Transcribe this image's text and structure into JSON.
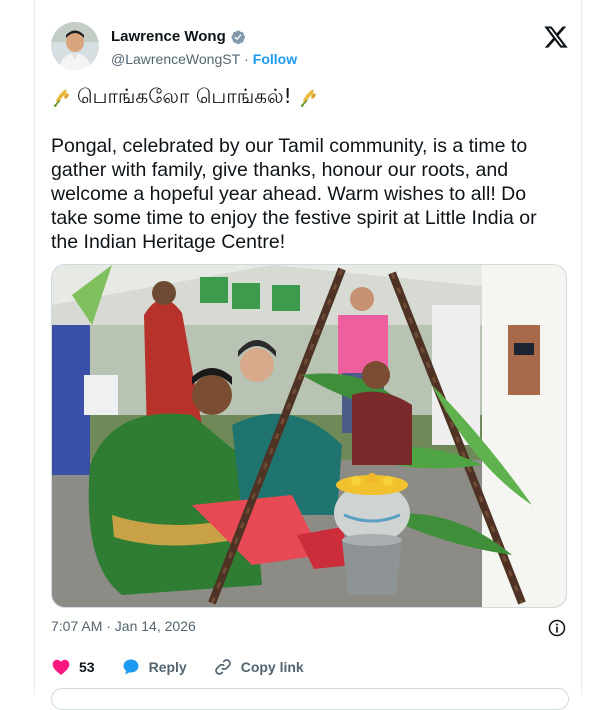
{
  "author": {
    "name": "Lawrence Wong",
    "handle": "@LawrenceWongST",
    "separator": "·",
    "follow_label": "Follow",
    "verified": true
  },
  "tweet": {
    "headline": "பொங்கலோ பொங்கல்!",
    "headline_emoji": "sheaf-of-rice-icon",
    "text": "Pongal, celebrated by our Tamil community, is a time to gather with family, give thanks, honour our roots, and welcome a hopeful year ahead. Warm wishes to all! Do take some time to enjoy the festive spirit at Little India or the Indian Heritage Centre!",
    "timestamp": "7:07 AM · Jan 14, 2026"
  },
  "actions": {
    "like_count": "53",
    "reply_label": "Reply",
    "copy_label": "Copy link"
  },
  "colors": {
    "accent": "#1d9bf0",
    "like": "#f91880",
    "text": "#0f1419",
    "muted": "#536471"
  }
}
